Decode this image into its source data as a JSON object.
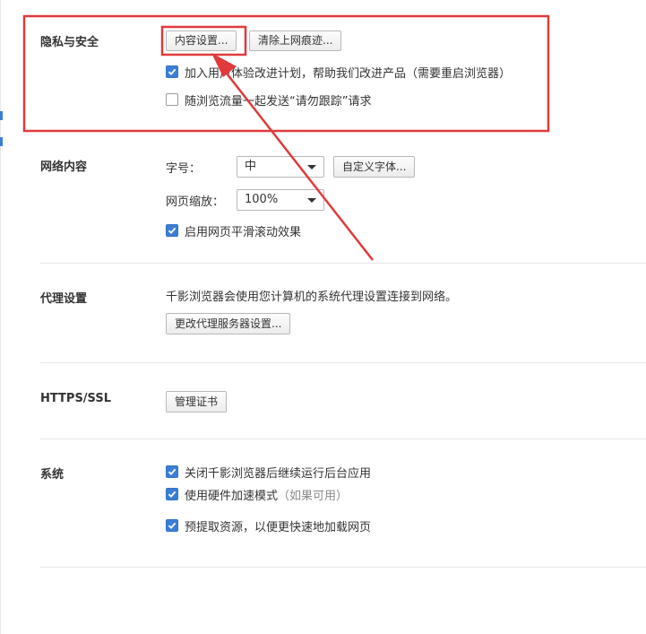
{
  "privacy": {
    "title": "隐私与安全",
    "content_settings_button": "内容设置...",
    "clear_history_button": "清除上网痕迹...",
    "ux_program_label": "加入用户体验改进计划，帮助我们改进产品",
    "ux_program_note": "（需要重启浏览器）",
    "ux_program_checked": true,
    "dnt_label": "随浏览流量一起发送“请勿跟踪”请求",
    "dnt_checked": false
  },
  "web_content": {
    "title": "网络内容",
    "font_size_label": "字号：",
    "font_size_value": "中",
    "custom_font_button": "自定义字体...",
    "zoom_label": "网页缩放：",
    "zoom_value": "100%",
    "smooth_scroll_label": "启用网页平滑滚动效果",
    "smooth_scroll_checked": true
  },
  "proxy": {
    "title": "代理设置",
    "description": "千影浏览器会使用您计算机的系统代理设置连接到网络。",
    "change_proxy_button": "更改代理服务器设置..."
  },
  "https": {
    "title": "HTTPS/SSL",
    "manage_certs_button": "管理证书"
  },
  "system": {
    "title": "系统",
    "background_run_label": "关闭千影浏览器后继续运行后台应用",
    "background_run_checked": true,
    "hw_accel_label": "使用硬件加速模式",
    "hw_accel_note": "（如果可用）",
    "hw_accel_checked": true,
    "prefetch_label": "预提取资源，以便更快速地加载网页",
    "prefetch_checked": true
  },
  "annotation": {
    "highlight_color": "#e03a3a",
    "accent_color": "#3b7fd5"
  }
}
